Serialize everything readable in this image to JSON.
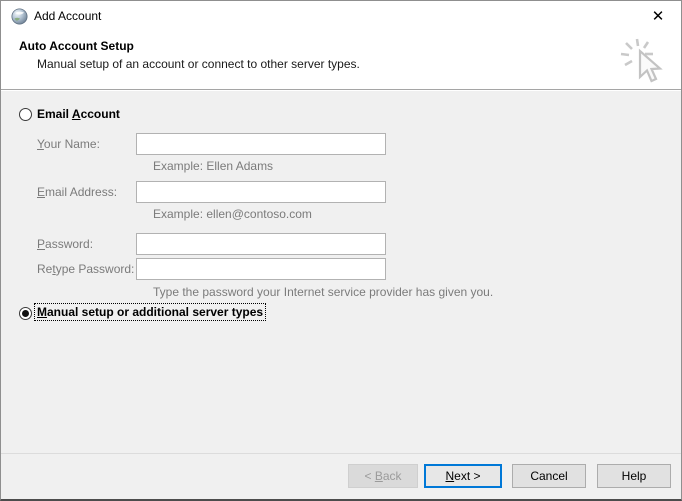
{
  "window": {
    "title": "Add Account",
    "close_glyph": "✕"
  },
  "header": {
    "title": "Auto Account Setup",
    "subtitle": "Manual setup of an account or connect to other server types."
  },
  "colors": {
    "accent": "#0078d7",
    "body_bg": "#f0f0f0",
    "muted_text": "#7b7b7b"
  },
  "form": {
    "email_account": {
      "pre": "Email ",
      "key": "A",
      "post": "ccount",
      "selected": false
    },
    "your_name": {
      "pre": "",
      "key": "Y",
      "post": "our Name:",
      "value": "",
      "example": "Example: Ellen Adams"
    },
    "email_address": {
      "pre": "",
      "key": "E",
      "post": "mail Address:",
      "value": "",
      "example": "Example: ellen@contoso.com"
    },
    "password": {
      "pre": "",
      "key": "P",
      "post": "assword:",
      "value": ""
    },
    "retype_password": {
      "pre": "Re",
      "key": "t",
      "post": "ype Password:",
      "value": ""
    },
    "password_hint": "Type the password your Internet service provider has given you.",
    "manual_setup": {
      "pre": "",
      "key": "M",
      "post": "anual setup or additional server types",
      "selected": true
    }
  },
  "buttons": {
    "back": {
      "pre": "< ",
      "key": "B",
      "post": "ack",
      "enabled": false
    },
    "next": {
      "pre": "",
      "key": "N",
      "post": "ext >",
      "default": true
    },
    "cancel": {
      "label": "Cancel"
    },
    "help": {
      "label": "Help"
    }
  }
}
